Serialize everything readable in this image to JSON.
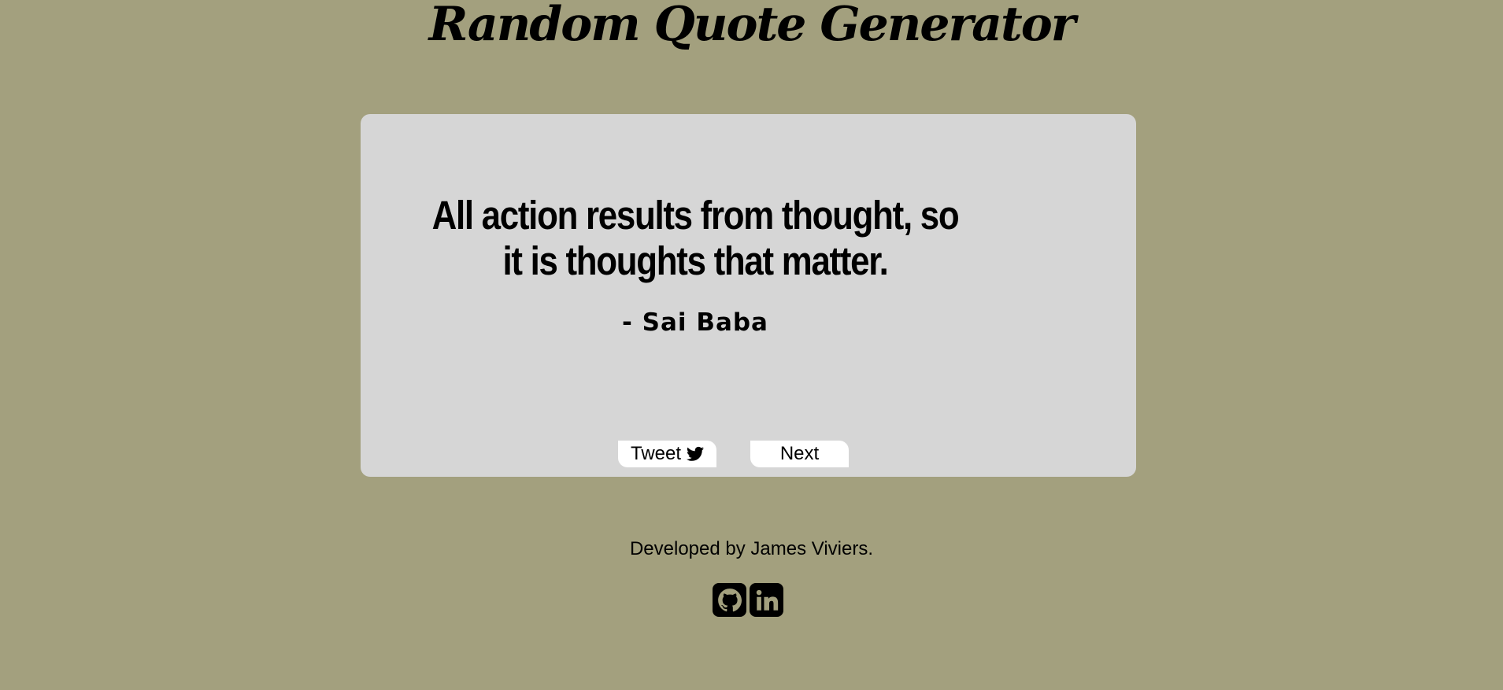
{
  "header": {
    "title": "Random Quote Generator"
  },
  "quote": {
    "text": "All action results from thought, so it is thoughts that matter.",
    "author": "- Sai Baba"
  },
  "actions": {
    "tweet_label": "Tweet",
    "tweet_icon": "twitter-icon",
    "next_label": "Next"
  },
  "footer": {
    "credit": "Developed by James Viviers.",
    "social": [
      {
        "icon": "github-icon"
      },
      {
        "icon": "linkedin-icon"
      }
    ]
  },
  "colors": {
    "background": "#a3a07e",
    "card": "#d6d6d6",
    "button": "#ffffff",
    "text": "#000000"
  }
}
